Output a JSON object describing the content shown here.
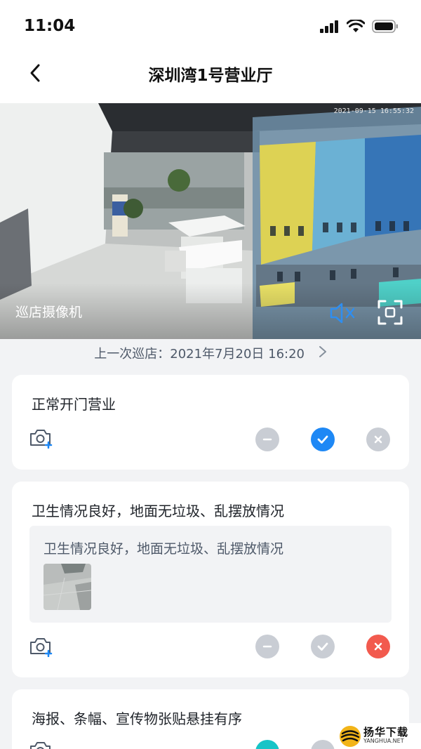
{
  "status_bar": {
    "time": "11:04"
  },
  "nav": {
    "title": "深圳湾1号营业厅"
  },
  "camera": {
    "timestamp": "2021-09-15  16:55:32",
    "label": "巡店摄像机"
  },
  "last_patrol": {
    "text": "上一次巡店：2021年7月20日   16:20"
  },
  "checklist": [
    {
      "title": "正常开门营业",
      "selected": "pass"
    },
    {
      "title": "卫生情况良好，地面无垃圾、乱摆放情况",
      "note": "卫生情况良好，地面无垃圾、乱摆放情况",
      "selected": "fail"
    },
    {
      "title": "海报、条幅、宣传物张贴悬挂有序",
      "selected": "na"
    }
  ],
  "colors": {
    "accent_blue": "#1e88f5",
    "fail_red": "#f25a4e",
    "option_gray": "#c9cdd4",
    "na_teal": "#17c4c7"
  },
  "watermark": {
    "title": "扬华下载",
    "site": "YANGHUA.NET"
  }
}
